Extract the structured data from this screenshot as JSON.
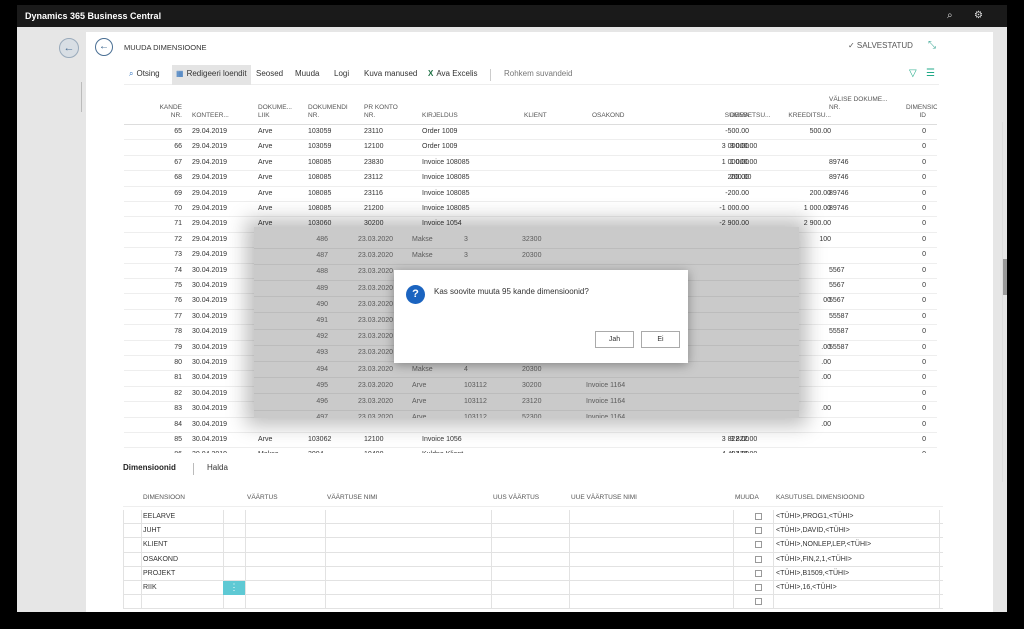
{
  "app": {
    "title": "Dynamics 365 Business Central",
    "icons": [
      "search-icon",
      "gear-icon"
    ]
  },
  "page": {
    "title": "MUUDA DIMENSIOONE",
    "saved": "✓ SALVESTATUD"
  },
  "actions": [
    {
      "label": "Otsing",
      "icon": "⌕"
    },
    {
      "label": "Redigeeri loendit",
      "icon": "▦"
    },
    {
      "label": "Seosed",
      "icon": ""
    },
    {
      "label": "Muuda",
      "icon": ""
    },
    {
      "label": "Logi",
      "icon": ""
    },
    {
      "label": "Kuva manused",
      "icon": ""
    },
    {
      "label": "Ava Excelis",
      "icon": "X"
    },
    {
      "label": "Rohkem suvandeid",
      "icon": ""
    }
  ],
  "grid": {
    "headers": [
      {
        "l1": "KANDE",
        "l2": "NR."
      },
      {
        "l1": "",
        "l2": "KONTEER..."
      },
      {
        "l1": "DOKUME...",
        "l2": "LIIK"
      },
      {
        "l1": "DOKUMENDI",
        "l2": "NR."
      },
      {
        "l1": "PR KONTO",
        "l2": "NR."
      },
      {
        "l1": "",
        "l2": "KIRJELDUS"
      },
      {
        "l1": "",
        "l2": "KLIENT"
      },
      {
        "l1": "",
        "l2": "OSAKOND"
      },
      {
        "l1": "",
        "l2": "SUMMA"
      },
      {
        "l1": "",
        "l2": "DEEBETSU..."
      },
      {
        "l1": "",
        "l2": "KREEDITSU..."
      },
      {
        "l1": "VÄLISE DOKUME...",
        "l2": "NR."
      },
      {
        "l1": "DIMENSIO...",
        "l2": "ID"
      }
    ],
    "rows": [
      [
        "65",
        "29.04.2019",
        "Arve",
        "103059",
        "23110",
        "Order 1009",
        "",
        "",
        "-500.00",
        "",
        "500.00",
        "",
        "0"
      ],
      [
        "66",
        "29.04.2019",
        "Arve",
        "103059",
        "12100",
        "Order 1009",
        "",
        "",
        "3 000.00",
        "3 000.00",
        "",
        "",
        "0"
      ],
      [
        "67",
        "29.04.2019",
        "Arve",
        "108085",
        "23830",
        "Invoice 108085",
        "",
        "",
        "1 000.00",
        "1 000.00",
        "",
        "89746",
        "0"
      ],
      [
        "68",
        "29.04.2019",
        "Arve",
        "108085",
        "23112",
        "Invoice 108085",
        "",
        "",
        "200.00",
        "200.00",
        "",
        "89746",
        "0"
      ],
      [
        "69",
        "29.04.2019",
        "Arve",
        "108085",
        "23116",
        "Invoice 108085",
        "",
        "",
        "-200.00",
        "",
        "200.00",
        "89746",
        "0"
      ],
      [
        "70",
        "29.04.2019",
        "Arve",
        "108085",
        "21200",
        "Invoice 108085",
        "",
        "",
        "-1 000.00",
        "",
        "1 000.00",
        "89746",
        "0"
      ],
      [
        "71",
        "29.04.2019",
        "Arve",
        "103060",
        "30200",
        "Invoice 1054",
        "",
        "",
        "-2 900.00",
        "",
        "2 900.00",
        "",
        "0"
      ],
      [
        "72",
        "29.04.2019",
        "",
        "",
        "",
        "",
        "",
        "",
        "",
        "",
        "100",
        "",
        "0"
      ],
      [
        "73",
        "29.04.2019",
        "",
        "",
        "",
        "",
        "",
        "",
        "",
        "",
        "",
        "",
        "0"
      ],
      [
        "74",
        "30.04.2019",
        "",
        "",
        "",
        "",
        "",
        "",
        "",
        "",
        "",
        "5567",
        "0"
      ],
      [
        "75",
        "30.04.2019",
        "",
        "",
        "",
        "",
        "",
        "",
        "",
        "",
        "",
        "5567",
        "0"
      ],
      [
        "76",
        "30.04.2019",
        "",
        "",
        "",
        "",
        "",
        "",
        "",
        "",
        "00",
        "5567",
        "0"
      ],
      [
        "77",
        "30.04.2019",
        "",
        "",
        "",
        "",
        "",
        "",
        "",
        "",
        "",
        "55587",
        "0"
      ],
      [
        "78",
        "30.04.2019",
        "",
        "",
        "",
        "",
        "",
        "",
        "",
        "",
        "",
        "55587",
        "0"
      ],
      [
        "79",
        "30.04.2019",
        "",
        "",
        "",
        "",
        "",
        "",
        "",
        "",
        ".00",
        "55587",
        "0"
      ],
      [
        "80",
        "30.04.2019",
        "",
        "",
        "",
        "",
        "",
        "",
        "",
        "",
        ".00",
        "",
        "0"
      ],
      [
        "81",
        "30.04.2019",
        "",
        "",
        "",
        "",
        "",
        "",
        "",
        "",
        ".00",
        "",
        "0"
      ],
      [
        "82",
        "30.04.2019",
        "",
        "",
        "",
        "",
        "",
        "",
        "",
        "",
        "",
        "",
        "0"
      ],
      [
        "83",
        "30.04.2019",
        "",
        "",
        "",
        "",
        "",
        "",
        "",
        "",
        ".00",
        "",
        "0"
      ],
      [
        "84",
        "30.04.2019",
        "",
        "",
        "",
        "",
        "",
        "",
        "",
        "",
        ".00",
        "",
        "0"
      ],
      [
        "85",
        "30.04.2019",
        "Arve",
        "103062",
        "12100",
        "Invoice 1056",
        "",
        "",
        "3 822.00",
        "3 822.00",
        "",
        "",
        "0"
      ],
      [
        "86",
        "30.04.2019",
        "Makse",
        "3004",
        "10400",
        "Kuldne Klient",
        "",
        "",
        "4 422.00",
        "4 422.00",
        "",
        "",
        "0"
      ]
    ]
  },
  "ghost_rows": [
    [
      "486",
      "23.03.2020",
      "Makse",
      "3",
      "32300",
      ""
    ],
    [
      "487",
      "23.03.2020",
      "Makse",
      "3",
      "20300",
      ""
    ],
    [
      "488",
      "23.03.2020",
      "",
      "",
      "",
      ""
    ],
    [
      "489",
      "23.03.2020",
      "",
      "",
      "",
      ""
    ],
    [
      "490",
      "23.03.2020",
      "",
      "",
      "",
      ""
    ],
    [
      "491",
      "23.03.2020",
      "",
      "",
      "",
      ""
    ],
    [
      "492",
      "23.03.2020",
      "",
      "",
      "",
      ""
    ],
    [
      "493",
      "23.03.2020",
      "",
      "",
      "",
      ""
    ],
    [
      "494",
      "23.03.2020",
      "Makse",
      "4",
      "20300",
      ""
    ],
    [
      "495",
      "23.03.2020",
      "Arve",
      "103112",
      "30200",
      "Invoice 1164"
    ],
    [
      "496",
      "23.03.2020",
      "Arve",
      "103112",
      "23120",
      "Invoice 1164"
    ],
    [
      "497",
      "23.03.2020",
      "Arve",
      "103112",
      "52300",
      "Invoice 1164"
    ]
  ],
  "dialog": {
    "message": "Kas soovite muuta 95 kande dimensioonid?",
    "yes": "Jah",
    "no": "Ei",
    "icon": "?"
  },
  "dim_tabs": {
    "dims": "Dimensioonid",
    "manage": "Halda"
  },
  "dims": {
    "headers": [
      "DIMENSIOON",
      "VÄÄRTUS",
      "VÄÄRTUSE NIMI",
      "UUS VÄÄRTUS",
      "UUE VÄÄRTUSE NIMI",
      "MUUDA",
      "KASUTUSEL DIMENSIOONID"
    ],
    "rows": [
      {
        "dim": "EELARVE",
        "used": "<TÜHI>,PROG1,<TÜHI>"
      },
      {
        "dim": "JUHT",
        "used": "<TÜHI>,DAVID,<TÜHI>"
      },
      {
        "dim": "KLIENT",
        "used": "<TÜHI>,NONLEP,LEP,<TÜHI>"
      },
      {
        "dim": "OSAKOND",
        "used": "<TÜHI>,FIN,2,1,<TÜHI>"
      },
      {
        "dim": "PROJEKT",
        "used": "<TÜHI>,B1509,<TÜHI>"
      },
      {
        "dim": "RIIK",
        "used": "<TÜHI>,16,<TÜHI>"
      },
      {
        "dim": "",
        "used": ""
      }
    ],
    "dots": "⋮"
  }
}
